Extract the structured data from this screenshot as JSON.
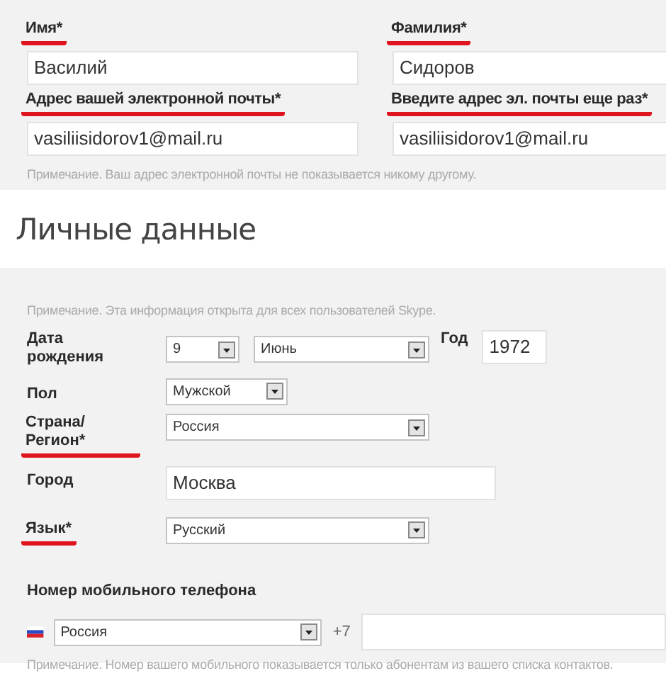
{
  "account": {
    "fields": [
      {
        "label": "Имя*",
        "underlined": true,
        "value": "Василий"
      },
      {
        "label": "Фамилия*",
        "underlined": true,
        "value": "Сидоров"
      },
      {
        "label": "Адрес вашей электронной почты*",
        "underlined": true,
        "value": "vasiliisidorov1@mail.ru"
      },
      {
        "label": "Введите адрес эл. почты еще раз*",
        "underlined": true,
        "value": "vasiliisidorov1@mail.ru"
      }
    ],
    "note": "Примечание. Ваш адрес электронной почты не показывается никому другому."
  },
  "personal": {
    "title": "Личные данные",
    "note": "Примечание. Эта информация открыта для всех пользователей Skype.",
    "rows": [
      {
        "label": "Дата рождения",
        "underlined": false,
        "controls": [
          {
            "kind": "select",
            "value": "9"
          },
          {
            "kind": "select",
            "value": "Июнь"
          },
          {
            "kind": "label",
            "text": "Год"
          },
          {
            "kind": "text",
            "value": "1972"
          }
        ]
      },
      {
        "label": "Пол",
        "underlined": false,
        "controls": [
          {
            "kind": "select",
            "value": "Мужской"
          }
        ]
      },
      {
        "label": "Страна/ Регион*",
        "underlined": true,
        "controls": [
          {
            "kind": "select",
            "value": "Россия"
          }
        ]
      },
      {
        "label": "Город",
        "underlined": false,
        "controls": [
          {
            "kind": "text",
            "value": "Москва"
          }
        ]
      },
      {
        "label": "Язык*",
        "underlined": true,
        "controls": [
          {
            "kind": "select",
            "value": "Русский"
          }
        ]
      }
    ],
    "phone": {
      "label": "Номер мобильного телефона",
      "country": "Россия",
      "code": "+7",
      "note": "Примечание. Номер вашего мобильного показывается только абонентам из вашего списка контактов."
    }
  }
}
